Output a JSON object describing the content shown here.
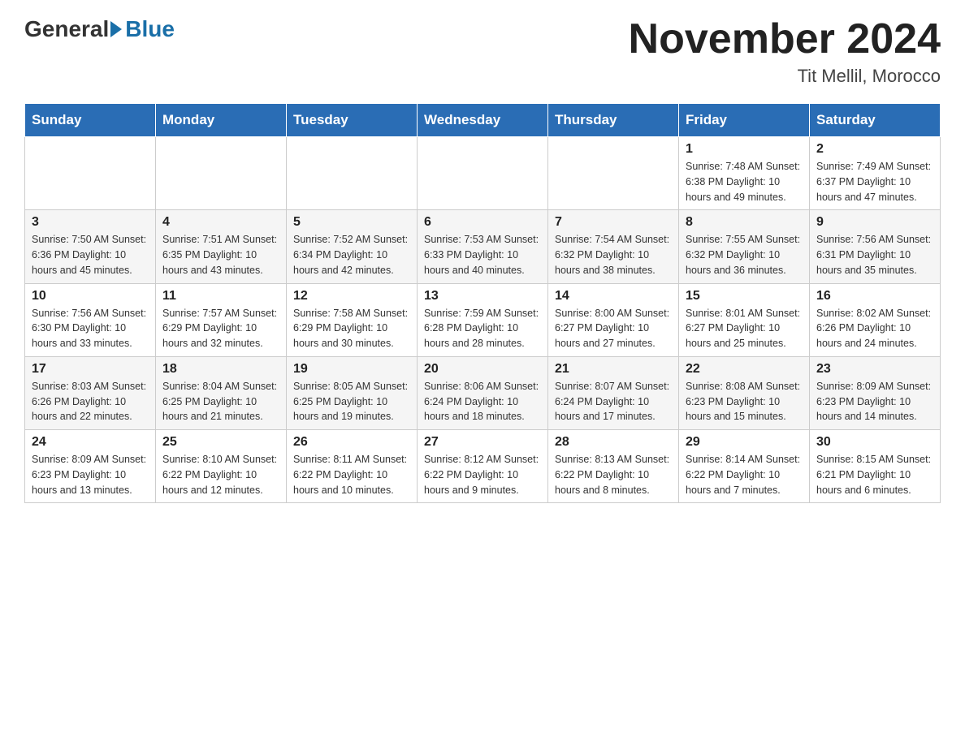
{
  "header": {
    "logo_general": "General",
    "logo_blue": "Blue",
    "month_title": "November 2024",
    "location": "Tit Mellil, Morocco"
  },
  "days_of_week": [
    "Sunday",
    "Monday",
    "Tuesday",
    "Wednesday",
    "Thursday",
    "Friday",
    "Saturday"
  ],
  "weeks": [
    [
      {
        "day": "",
        "info": ""
      },
      {
        "day": "",
        "info": ""
      },
      {
        "day": "",
        "info": ""
      },
      {
        "day": "",
        "info": ""
      },
      {
        "day": "",
        "info": ""
      },
      {
        "day": "1",
        "info": "Sunrise: 7:48 AM\nSunset: 6:38 PM\nDaylight: 10 hours and 49 minutes."
      },
      {
        "day": "2",
        "info": "Sunrise: 7:49 AM\nSunset: 6:37 PM\nDaylight: 10 hours and 47 minutes."
      }
    ],
    [
      {
        "day": "3",
        "info": "Sunrise: 7:50 AM\nSunset: 6:36 PM\nDaylight: 10 hours and 45 minutes."
      },
      {
        "day": "4",
        "info": "Sunrise: 7:51 AM\nSunset: 6:35 PM\nDaylight: 10 hours and 43 minutes."
      },
      {
        "day": "5",
        "info": "Sunrise: 7:52 AM\nSunset: 6:34 PM\nDaylight: 10 hours and 42 minutes."
      },
      {
        "day": "6",
        "info": "Sunrise: 7:53 AM\nSunset: 6:33 PM\nDaylight: 10 hours and 40 minutes."
      },
      {
        "day": "7",
        "info": "Sunrise: 7:54 AM\nSunset: 6:32 PM\nDaylight: 10 hours and 38 minutes."
      },
      {
        "day": "8",
        "info": "Sunrise: 7:55 AM\nSunset: 6:32 PM\nDaylight: 10 hours and 36 minutes."
      },
      {
        "day": "9",
        "info": "Sunrise: 7:56 AM\nSunset: 6:31 PM\nDaylight: 10 hours and 35 minutes."
      }
    ],
    [
      {
        "day": "10",
        "info": "Sunrise: 7:56 AM\nSunset: 6:30 PM\nDaylight: 10 hours and 33 minutes."
      },
      {
        "day": "11",
        "info": "Sunrise: 7:57 AM\nSunset: 6:29 PM\nDaylight: 10 hours and 32 minutes."
      },
      {
        "day": "12",
        "info": "Sunrise: 7:58 AM\nSunset: 6:29 PM\nDaylight: 10 hours and 30 minutes."
      },
      {
        "day": "13",
        "info": "Sunrise: 7:59 AM\nSunset: 6:28 PM\nDaylight: 10 hours and 28 minutes."
      },
      {
        "day": "14",
        "info": "Sunrise: 8:00 AM\nSunset: 6:27 PM\nDaylight: 10 hours and 27 minutes."
      },
      {
        "day": "15",
        "info": "Sunrise: 8:01 AM\nSunset: 6:27 PM\nDaylight: 10 hours and 25 minutes."
      },
      {
        "day": "16",
        "info": "Sunrise: 8:02 AM\nSunset: 6:26 PM\nDaylight: 10 hours and 24 minutes."
      }
    ],
    [
      {
        "day": "17",
        "info": "Sunrise: 8:03 AM\nSunset: 6:26 PM\nDaylight: 10 hours and 22 minutes."
      },
      {
        "day": "18",
        "info": "Sunrise: 8:04 AM\nSunset: 6:25 PM\nDaylight: 10 hours and 21 minutes."
      },
      {
        "day": "19",
        "info": "Sunrise: 8:05 AM\nSunset: 6:25 PM\nDaylight: 10 hours and 19 minutes."
      },
      {
        "day": "20",
        "info": "Sunrise: 8:06 AM\nSunset: 6:24 PM\nDaylight: 10 hours and 18 minutes."
      },
      {
        "day": "21",
        "info": "Sunrise: 8:07 AM\nSunset: 6:24 PM\nDaylight: 10 hours and 17 minutes."
      },
      {
        "day": "22",
        "info": "Sunrise: 8:08 AM\nSunset: 6:23 PM\nDaylight: 10 hours and 15 minutes."
      },
      {
        "day": "23",
        "info": "Sunrise: 8:09 AM\nSunset: 6:23 PM\nDaylight: 10 hours and 14 minutes."
      }
    ],
    [
      {
        "day": "24",
        "info": "Sunrise: 8:09 AM\nSunset: 6:23 PM\nDaylight: 10 hours and 13 minutes."
      },
      {
        "day": "25",
        "info": "Sunrise: 8:10 AM\nSunset: 6:22 PM\nDaylight: 10 hours and 12 minutes."
      },
      {
        "day": "26",
        "info": "Sunrise: 8:11 AM\nSunset: 6:22 PM\nDaylight: 10 hours and 10 minutes."
      },
      {
        "day": "27",
        "info": "Sunrise: 8:12 AM\nSunset: 6:22 PM\nDaylight: 10 hours and 9 minutes."
      },
      {
        "day": "28",
        "info": "Sunrise: 8:13 AM\nSunset: 6:22 PM\nDaylight: 10 hours and 8 minutes."
      },
      {
        "day": "29",
        "info": "Sunrise: 8:14 AM\nSunset: 6:22 PM\nDaylight: 10 hours and 7 minutes."
      },
      {
        "day": "30",
        "info": "Sunrise: 8:15 AM\nSunset: 6:21 PM\nDaylight: 10 hours and 6 minutes."
      }
    ]
  ]
}
